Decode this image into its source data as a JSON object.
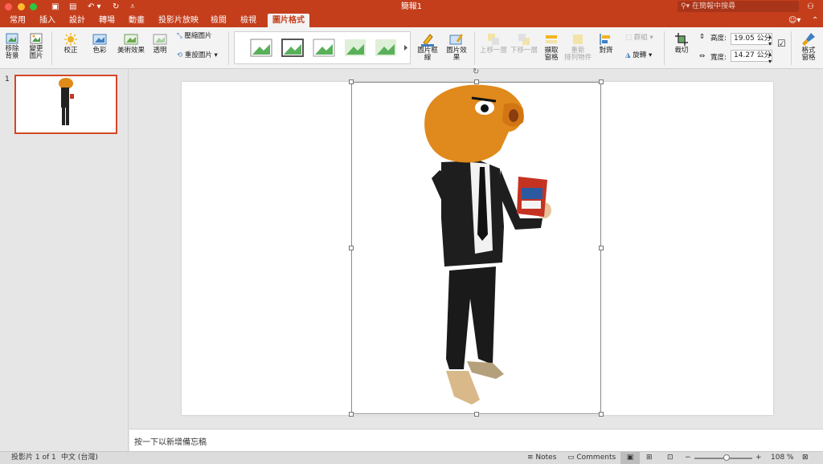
{
  "window": {
    "title": "簡報1",
    "search_placeholder": "在簡報中搜尋"
  },
  "tabs": [
    {
      "label": "常用"
    },
    {
      "label": "插入"
    },
    {
      "label": "設計"
    },
    {
      "label": "轉場"
    },
    {
      "label": "動畫"
    },
    {
      "label": "投影片放映"
    },
    {
      "label": "檢閱"
    },
    {
      "label": "檢視"
    },
    {
      "label": "圖片格式"
    }
  ],
  "ribbon": {
    "remove_bg_line1": "移除",
    "remove_bg_line2": "背景",
    "change_pic_line1": "變更",
    "change_pic_line2": "圖片",
    "corrections": "校正",
    "color": "色彩",
    "artistic": "美術效果",
    "transparency": "透明",
    "compress": "壓縮圖片",
    "reset": "重設圖片",
    "picture_border": "圖片框線",
    "picture_effects": "圖片效果",
    "bring_forward": "上移一層",
    "send_backward": "下移一層",
    "selection_pane_line1": "擷取",
    "selection_pane_line2": "窗格",
    "rearrange_line1": "重新",
    "rearrange_line2": "排列物件",
    "align": "對齊",
    "group": "群組",
    "rotate": "旋轉",
    "crop": "裁切",
    "height_label": "高度:",
    "height_value": "19.05 公分",
    "width_label": "寬度:",
    "width_value": "14.27 公分",
    "format_pane_line1": "格式",
    "format_pane_line2": "窗格"
  },
  "thumbnails": {
    "slide_number": "1"
  },
  "notes": {
    "placeholder": "按一下以新增備忘稿"
  },
  "status": {
    "slide_info": "投影片 1 of 1",
    "language": "中文 (台灣)",
    "notes_label": "Notes",
    "comments_label": "Comments",
    "zoom": "108 %",
    "zoom_fraction": 0.55
  },
  "colors": {
    "accent": "#c43e1c",
    "ribbon_bg": "#f3f3f3"
  }
}
